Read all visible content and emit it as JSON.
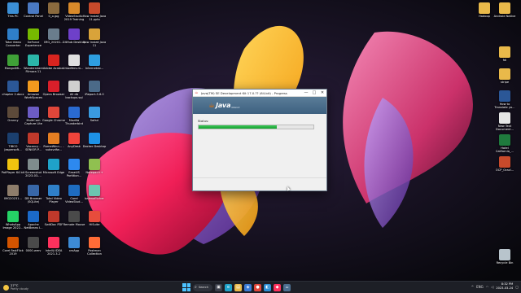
{
  "desktop": {
    "left_icons": [
      {
        "label": "This PC",
        "color": "#3b8fd6"
      },
      {
        "label": "Control Panel",
        "color": "#4a79c2"
      },
      {
        "label": "0_o.jpg",
        "color": "#8a6a3e"
      },
      {
        "label": "VideoStudio 2019 Training",
        "color": "#d8892a"
      },
      {
        "label": "How Install Java 11.pptx",
        "color": "#c84a2b"
      },
      {
        "label": "Total Video Converter",
        "color": "#2f7fc9"
      },
      {
        "label": "GeForce Experience",
        "color": "#76b900"
      },
      {
        "label": "IMG_20201...",
        "color": "#6a7d8c"
      },
      {
        "label": "GitHub Desktop",
        "color": "#6e40c9"
      },
      {
        "label": "How Install Java 11",
        "color": "#d9a33a"
      },
      {
        "label": "MongoDB...",
        "color": "#3fa037"
      },
      {
        "label": "Wondershare Filmora 11",
        "color": "#2bb6a8"
      },
      {
        "label": "Adobe Acrobat",
        "color": "#d8241f"
      },
      {
        "label": "modfers.m...",
        "color": "#e0e0e0"
      },
      {
        "label": "Internetdo...",
        "color": "#2e9ee0"
      },
      {
        "label": "chapter 2.docx",
        "color": "#2b5797"
      },
      {
        "label": "Amazon WorkSpaces",
        "color": "#f39a1e"
      },
      {
        "label": "Opera Browser",
        "color": "#d91f2a"
      },
      {
        "label": "All db backups.sql",
        "color": "#cfcfcf"
      },
      {
        "label": "iReport-5.6.0",
        "color": "#4b6a88"
      },
      {
        "label": "Granny",
        "color": "#5d4a3a"
      },
      {
        "label": "MultiCam Capture Lite",
        "color": "#6c5cc4"
      },
      {
        "label": "Google Chrome",
        "color": "#e0463a"
      },
      {
        "label": "Mozilla Thunderbird",
        "color": "#2a6ad1"
      },
      {
        "label": "Safari",
        "color": "#3a9ae0"
      },
      {
        "label": "TIBCO Jaspersoft...",
        "color": "#1b3f6e"
      },
      {
        "label": "Vacancy - SENIOR P...",
        "color": "#c0392b"
      },
      {
        "label": "RumeWinn... - subsvdfw...",
        "color": "#e67e22"
      },
      {
        "label": "AnyDesk",
        "color": "#ef443b"
      },
      {
        "label": "Docker Desktop",
        "color": "#1d91e6"
      },
      {
        "label": "PotPlayer 64 bit",
        "color": "#f1c40f"
      },
      {
        "label": "Screenshot 2023-03-...",
        "color": "#7f8c8d"
      },
      {
        "label": "Microsoft Edge",
        "color": "#1fa2c9"
      },
      {
        "label": "EaseUS Partition...",
        "color": "#2d89ef"
      },
      {
        "label": "Notepad++",
        "color": "#90c050"
      },
      {
        "label": "IMG20231...",
        "color": "#8e7d6b"
      },
      {
        "label": "DB Browser (SQLite)",
        "color": "#3867a8"
      },
      {
        "label": "Total Video Player",
        "color": "#2f80c9"
      },
      {
        "label": "Corel VideoStud...",
        "color": "#1e6cc0"
      },
      {
        "label": "balenaEtcher",
        "color": "#6cc5b0"
      },
      {
        "label": "WhatsApp Image 2022...",
        "color": "#25d366"
      },
      {
        "label": "Apache NetBeans I...",
        "color": "#1b6ac9"
      },
      {
        "label": "SwitDoc PDF",
        "color": "#c0392b"
      },
      {
        "label": "Remote Mouse",
        "color": "#4a4a4a"
      },
      {
        "label": "HiSuite",
        "color": "#e74c3c"
      },
      {
        "label": "Corel FastFlick 2019",
        "color": "#d35400"
      },
      {
        "label": "0000.wmv",
        "color": "#4a4a4a"
      },
      {
        "label": "IntelliJ IDEA 2021.3.2",
        "color": "#fe315d"
      },
      {
        "label": "xrsApp",
        "color": "#3d8bd6"
      },
      {
        "label": "Postman Collection",
        "color": "#ff6c37"
      }
    ],
    "right_icons": [
      {
        "label": "Hadoop",
        "color": "#e9b94a"
      },
      {
        "label": "Android Native",
        "color": "#e9b94a"
      },
      {
        "label": "fdl",
        "color": "#e9b94a"
      },
      {
        "label": "stripe",
        "color": "#e9b94a"
      },
      {
        "label": "How to Translate yo...",
        "color": "#2b5797"
      },
      {
        "label": "New Text Document...",
        "color": "#e6e6e6"
      },
      {
        "label": "Hotel California_...",
        "color": "#1f7a3d"
      },
      {
        "label": "OCP_Oracl...",
        "color": "#c84a2b"
      },
      {
        "label": "Recycle Bin",
        "color": "#b8c4cc"
      }
    ]
  },
  "installer": {
    "title": "Java(TM) SE Development Kit 17.0.?? (64-bit) - Progress",
    "minimize": "—",
    "maximize": "□",
    "close": "✕",
    "logo_word": "Java",
    "logo_sub": "ORACLE",
    "status_label": "Status:",
    "progress": 0.68
  },
  "taskbar": {
    "temperature": "27°C",
    "weather_desc": "Partly cloudy",
    "search_label": "Search",
    "search_icon": "⌕",
    "apps": [
      {
        "name": "task-view",
        "glyph": "▣",
        "color": "#3b3f4a"
      },
      {
        "name": "edge",
        "glyph": "e",
        "color": "#1fa2c9"
      },
      {
        "name": "file-explorer",
        "glyph": "▤",
        "color": "#e9b94a"
      },
      {
        "name": "store",
        "glyph": "◈",
        "color": "#3a7bd5"
      },
      {
        "name": "chrome",
        "glyph": "●",
        "color": "#e0463a"
      },
      {
        "name": "vscode",
        "glyph": "◧",
        "color": "#2b8fd6"
      },
      {
        "name": "intellij",
        "glyph": "◆",
        "color": "#fe315d"
      },
      {
        "name": "java-installer",
        "glyph": "☕",
        "color": "#4c6f90"
      }
    ],
    "tray_lang": "ENG",
    "time": "8:32 PM",
    "date": "2023-03-24"
  }
}
